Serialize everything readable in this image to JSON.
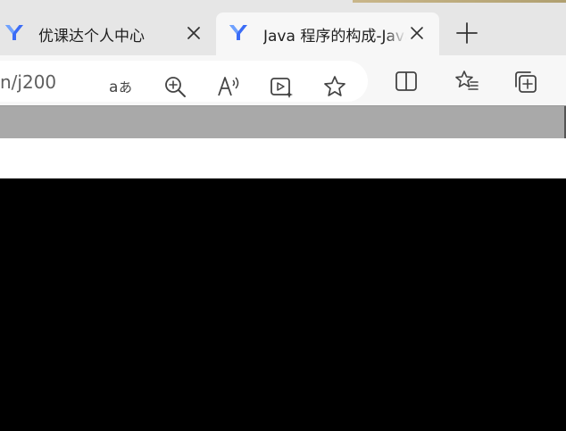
{
  "colors": {
    "tab_strip": "#e6e6e6",
    "active_tab": "#f7f7f7",
    "toolbar": "#f7f7f7",
    "address_bar": "#ffffff",
    "page_strip": "#a9a9a9",
    "page_band": "#ffffff",
    "page_body": "#000000",
    "logo_blue": "#3b6cf6"
  },
  "tabs": [
    {
      "title": "优课达个人中心",
      "icon": "youkeda-logo-icon",
      "active": false
    },
    {
      "title": "Java 程序的构成-Java",
      "icon": "youkeda-logo-icon",
      "active": true
    }
  ],
  "address_bar": {
    "url_visible": "n/j200"
  },
  "toolbar_icons": [
    "read-aloud-translate-icon",
    "zoom-in-icon",
    "read-aloud-icon",
    "video-enhance-icon",
    "favorite-star-icon",
    "split-screen-icon",
    "favorites-list-icon",
    "collections-icon"
  ]
}
